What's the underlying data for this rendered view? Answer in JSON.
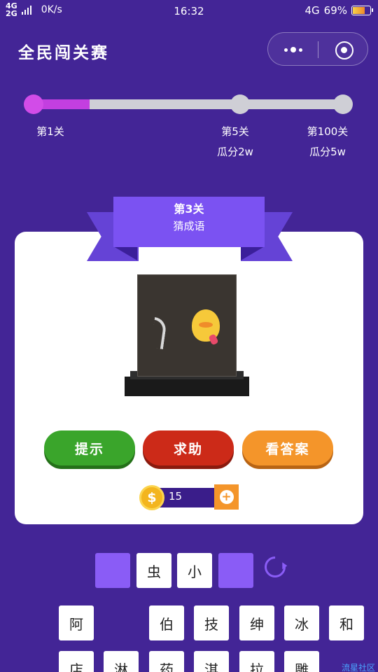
{
  "status_bar": {
    "network_top": "4G",
    "network_bottom": "2G",
    "speed": "0K/s",
    "time": "16:32",
    "signal_type": "4G",
    "battery": "69%"
  },
  "title_bar": {
    "title": "全民闯关赛",
    "more_icon": "more-dots-icon",
    "close_icon": "target-icon"
  },
  "progress": {
    "current_fraction": 0.18,
    "milestones": [
      {
        "level": "第1关",
        "reward": ""
      },
      {
        "level": "第5关",
        "reward": "瓜分2w"
      },
      {
        "level": "第100关",
        "reward": "瓜分5w"
      }
    ]
  },
  "puzzle": {
    "level": "第3关",
    "mode": "猜成语"
  },
  "buttons": {
    "hint": "提示",
    "help": "求助",
    "answer": "看答案"
  },
  "coins": {
    "count": "15",
    "symbol": "$"
  },
  "answer_slots": [
    "",
    "虫",
    "小",
    ""
  ],
  "candidates_row1": [
    "阿",
    "",
    "伯",
    "技",
    "绅",
    "冰",
    "和"
  ],
  "candidates_row2": [
    "店",
    "淋",
    "药",
    "淇",
    "拉",
    "雕"
  ],
  "watermark": "流星社区",
  "colors": {
    "background": "#432596",
    "accent": "#7b52f2",
    "progress_active": "#c33fe0",
    "hint_button": "#3aa52b",
    "help_button": "#cc2a18",
    "answer_button": "#f4952a"
  }
}
